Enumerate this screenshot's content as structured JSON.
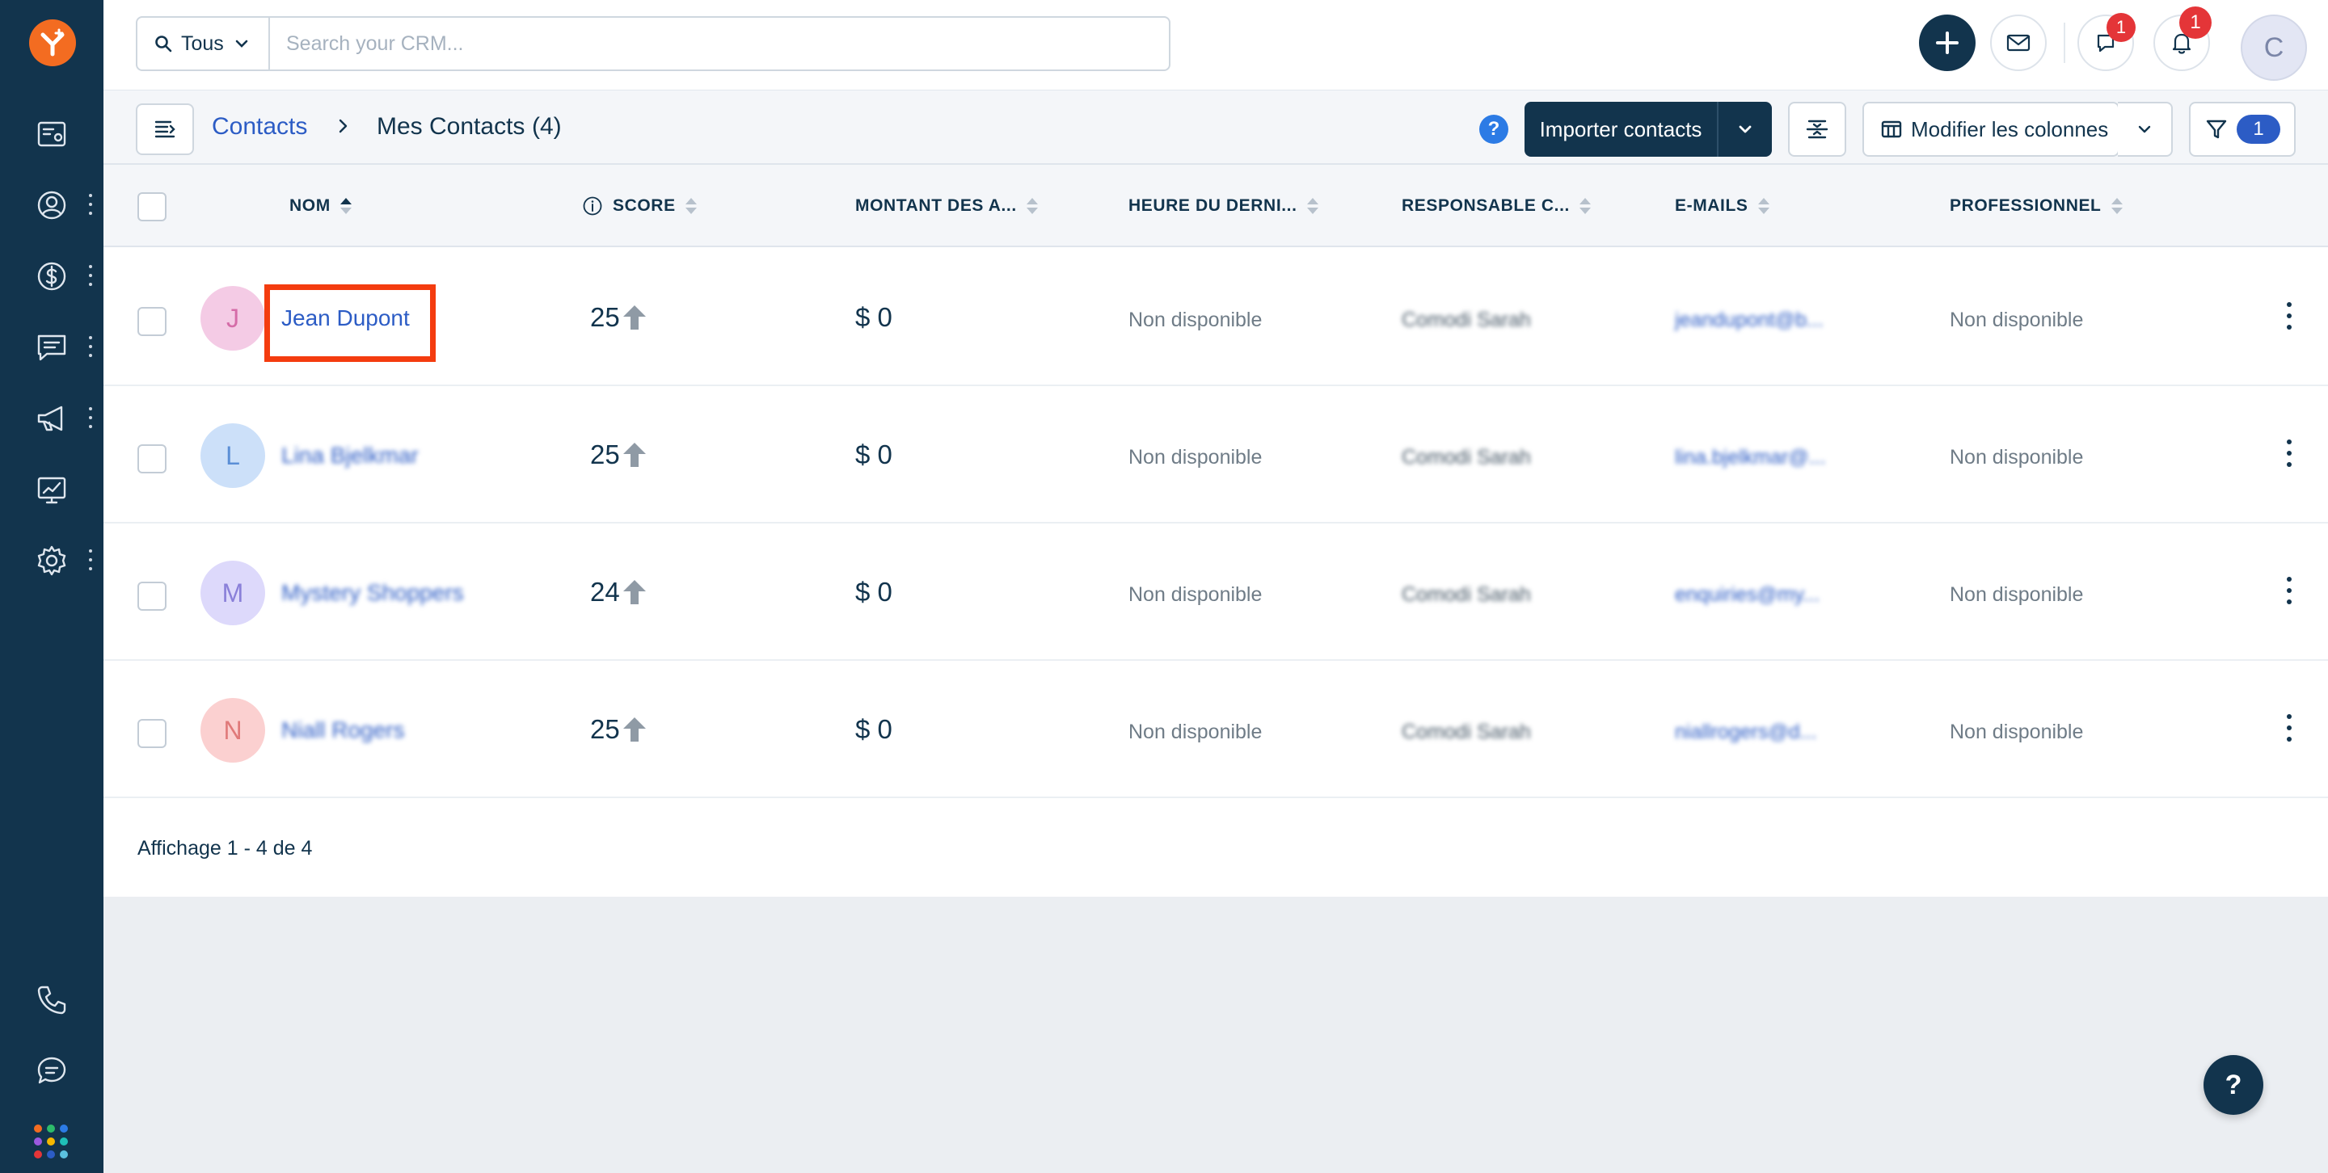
{
  "search": {
    "scope_label": "Tous",
    "placeholder": "Search your CRM..."
  },
  "topbar": {
    "chat_badge": "1",
    "notifications_badge": "1",
    "avatar_initial": "C"
  },
  "breadcrumb": {
    "root": "Contacts",
    "current": "Mes Contacts",
    "count": "(4)"
  },
  "toolbar": {
    "help_label": "?",
    "import_label": "Importer contacts",
    "edit_columns_label": "Modifier les colonnes",
    "filter_count": "1"
  },
  "table": {
    "columns": [
      "NOM",
      "SCORE",
      "MONTANT DES A...",
      "HEURE DU DERNI...",
      "RESPONSABLE C...",
      "E-MAILS",
      "PROFESSIONNEL"
    ],
    "rows": [
      {
        "initial": "J",
        "name": "Jean Dupont",
        "score": "25",
        "amount": "$ 0",
        "last_time": "Non disponible",
        "owner": "Comodi Sarah",
        "email": "jeandupont@b...",
        "professional": "Non disponible"
      },
      {
        "initial": "L",
        "name": "Lina Bjelkmar",
        "score": "25",
        "amount": "$ 0",
        "last_time": "Non disponible",
        "owner": "Comodi Sarah",
        "email": "lina.bjelkmar@...",
        "professional": "Non disponible"
      },
      {
        "initial": "M",
        "name": "Mystery Shoppers",
        "score": "24",
        "amount": "$ 0",
        "last_time": "Non disponible",
        "owner": "Comodi Sarah",
        "email": "enquiries@my...",
        "professional": "Non disponible"
      },
      {
        "initial": "N",
        "name": "Niall Rogers",
        "score": "25",
        "amount": "$ 0",
        "last_time": "Non disponible",
        "owner": "Comodi Sarah",
        "email": "niallrogers@d...",
        "professional": "Non disponible"
      }
    ],
    "footer": "Affichage 1 - 4 de 4"
  },
  "fab": {
    "help_label": "?"
  },
  "colors": {
    "sidebar_bg": "#12344d",
    "brand_orange": "#f36c21",
    "link_blue": "#2c5cc5",
    "badge_red": "#e43538",
    "highlight_red": "#f43c0f",
    "avatar_colors": [
      "#f4cbe5",
      "#cce0f9",
      "#ddd9fb",
      "#fbd0d0"
    ]
  },
  "icons": {
    "sidebar": [
      "freshworks-logo",
      "dashboard-icon",
      "contacts-icon",
      "deals-icon",
      "conversations-icon",
      "campaigns-icon",
      "analytics-icon",
      "settings-icon",
      "phone-icon",
      "chat-icon",
      "apps-grid-icon"
    ]
  }
}
